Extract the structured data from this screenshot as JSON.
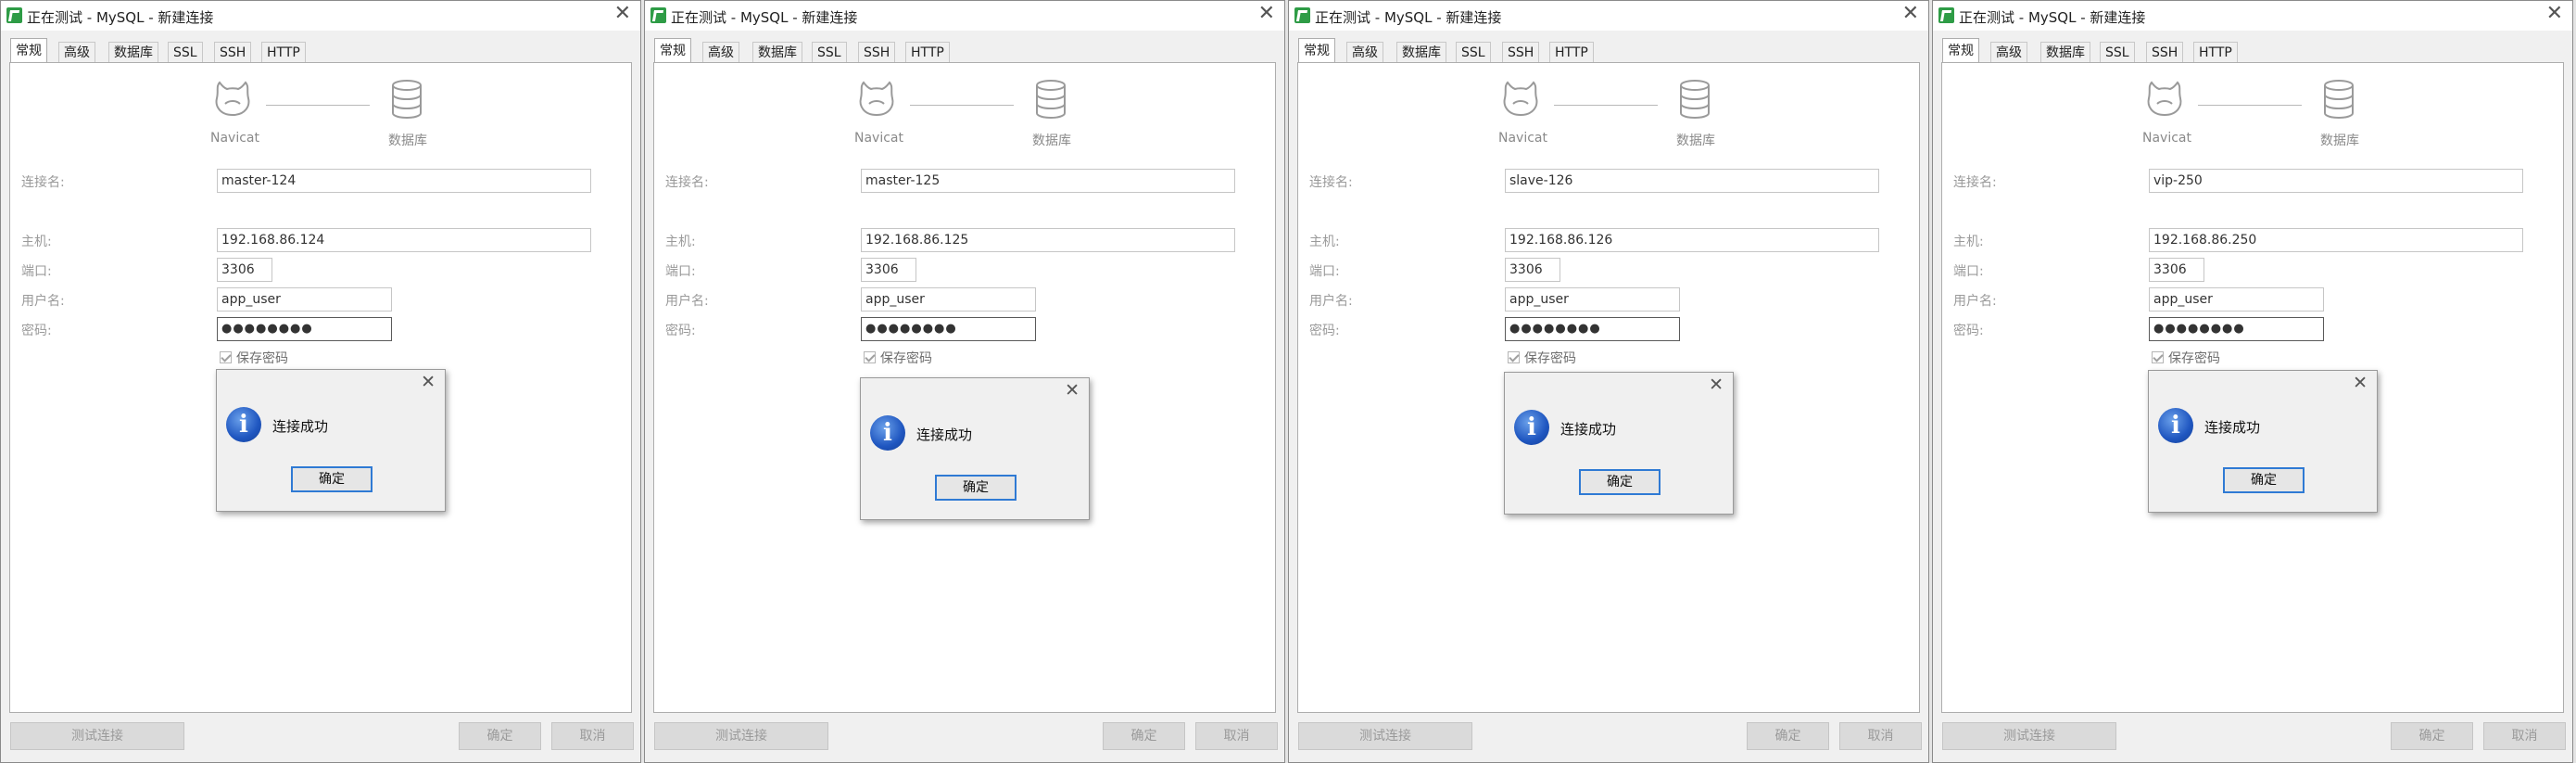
{
  "window": {
    "title": "正在测试 - MySQL - 新建连接",
    "tabs": [
      "常规",
      "高级",
      "数据库",
      "SSL",
      "SSH",
      "HTTP"
    ]
  },
  "labels": {
    "navicat": "Navicat",
    "database": "数据库",
    "connection_name": "连接名:",
    "host": "主机:",
    "port": "端口:",
    "username": "用户名:",
    "password": "密码:",
    "save_password": "保存密码"
  },
  "buttons": {
    "test": "测试连接",
    "ok": "确定",
    "cancel": "取消"
  },
  "dialog": {
    "message": "连接成功",
    "ok": "确定"
  },
  "panels": [
    {
      "connection_name": "master-124",
      "host": "192.168.86.124",
      "port": "3306",
      "username": "app_user",
      "password": "●●●●●●●●"
    },
    {
      "connection_name": "master-125",
      "host": "192.168.86.125",
      "port": "3306",
      "username": "app_user",
      "password": "●●●●●●●●"
    },
    {
      "connection_name": "slave-126",
      "host": "192.168.86.126",
      "port": "3306",
      "username": "app_user",
      "password": "●●●●●●●●"
    },
    {
      "connection_name": "vip-250",
      "host": "192.168.86.250",
      "port": "3306",
      "username": "app_user",
      "password": "●●●●●●●●"
    }
  ]
}
